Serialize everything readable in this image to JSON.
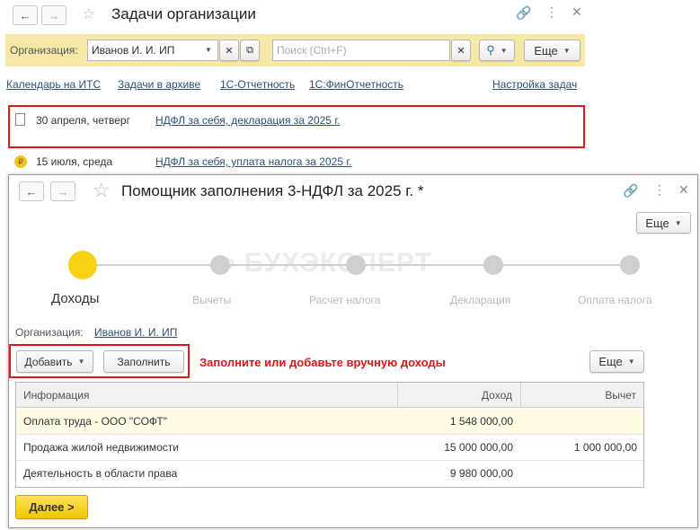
{
  "outer": {
    "title": "Задачи организации",
    "filter": {
      "org_label": "Организация:",
      "org_value": "Иванов И. И. ИП",
      "search_placeholder": "Поиск (Ctrl+F)",
      "more_label": "Еще"
    },
    "links": [
      "Календарь на ИТС",
      "Задачи в архиве",
      "1С-Отчетность",
      "1С:ФинОтчетность"
    ],
    "settings_link": "Настройка задач",
    "tasks": [
      {
        "date": "30 апреля, четверг",
        "name": "НДФЛ за себя, декларация за 2025 г."
      },
      {
        "date": "15 июля, среда",
        "name": "НДФЛ за себя, уплата налога за 2025 г."
      }
    ]
  },
  "inner": {
    "title": "Помощник заполнения 3-НДФЛ за 2025 г. *",
    "more_label": "Еще",
    "watermark": "БУХЭКСПЕРТ",
    "steps": [
      "Доходы",
      "Вычеты",
      "Расчет налога",
      "Декларация",
      "Оплата налога"
    ],
    "active_step": 0,
    "org_label": "Организация:",
    "org_value": "Иванов И. И. ИП",
    "add_label": "Добавить",
    "fill_label": "Заполнить",
    "hint": "Заполните или добавьте вручную доходы",
    "table_more_label": "Еще",
    "table": {
      "columns": [
        "Информация",
        "Доход",
        "Вычет"
      ],
      "rows": [
        [
          "Оплата труда - ООО \"СОФТ\"",
          "1 548 000,00",
          ""
        ],
        [
          "Продажа жилой недвижимости",
          "15 000 000,00",
          "1 000 000,00"
        ],
        [
          "Деятельность в области права",
          "9 980 000,00",
          ""
        ]
      ]
    },
    "next_label": "Далее >"
  },
  "colors": {
    "accent_yellow": "#f9d313",
    "highlight_red": "#e0141b",
    "link": "#2b4f7a",
    "hint_red": "#e0141b"
  }
}
